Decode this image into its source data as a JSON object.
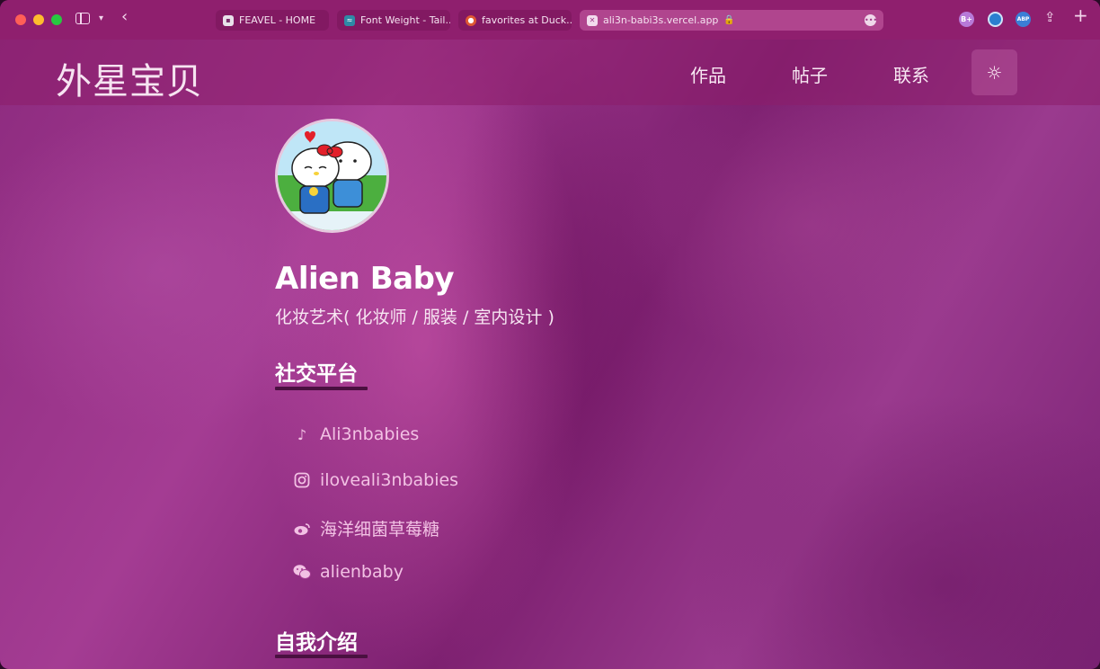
{
  "browser": {
    "tabs": [
      {
        "title": "FEAVEL - HOME",
        "favicon": "page-icon"
      },
      {
        "title": "Font Weight - Tail...",
        "favicon": "tailwind-icon"
      },
      {
        "title": "favorites at Duck...",
        "favicon": "duckduckgo-icon"
      },
      {
        "title": "ali3n-babi3s.vercel.app",
        "favicon": "vercel-icon",
        "active": true
      }
    ],
    "extensions": [
      "B+",
      "ABP"
    ]
  },
  "site": {
    "logo": "外星宝贝",
    "nav": [
      "作品",
      "帖子",
      "联系"
    ],
    "theme_toggle_icon": "sun-icon"
  },
  "profile": {
    "name": "Alien Baby",
    "subtitle": "化妆艺术( 化妆师 / 服装 / 室内设计 )",
    "avatar_desc": "hello-kitty-avatar"
  },
  "sections": {
    "social_title": "社交平台",
    "intro_title": "自我介绍"
  },
  "social": [
    {
      "platform": "tiktok",
      "icon": "tiktok-icon",
      "label": "Ali3nbabies"
    },
    {
      "platform": "instagram",
      "icon": "instagram-icon",
      "label": "iloveali3nbabies"
    },
    {
      "platform": "weibo",
      "icon": "weibo-icon",
      "label": "海洋细菌草莓糖"
    },
    {
      "platform": "wechat",
      "icon": "wechat-icon",
      "label": "alienbaby"
    }
  ],
  "colors": {
    "chrome": "#8f1f6e",
    "accent_text": "#f2c1e4",
    "underline": "#4a1040"
  }
}
